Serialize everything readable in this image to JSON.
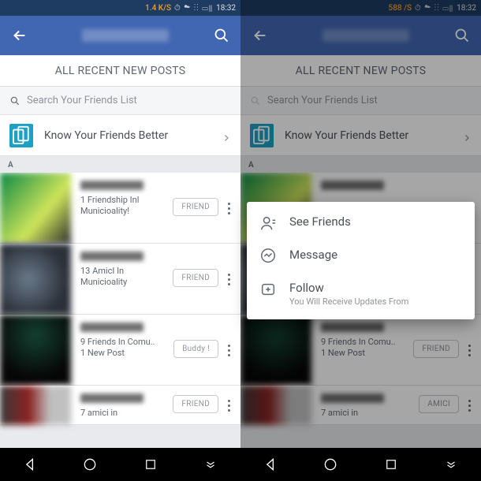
{
  "statusbar": {
    "left_speed": "1.4 K/S",
    "right_speed": "588 /S",
    "time": "18:32",
    "_icons": "⏰ 📶 🔋"
  },
  "header": {
    "back": "←",
    "search": "🔍"
  },
  "topnav_label": "ALL RECENT NEW POSTS",
  "search_placeholder": "Search Your Friends List",
  "know_label": "Know Your Friends Better",
  "section_header": "A",
  "buttons": {
    "friend": "FRIEND",
    "buddy": "Buddy !",
    "amici": "AMICI"
  },
  "items": [
    {
      "sub": "1 Friendship Inl",
      "sub2": "Municioality!",
      "btn": "friend"
    },
    {
      "sub": "13 AmicI In",
      "sub2": "Municioality",
      "btn": "friend"
    },
    {
      "sub": "9 Friends In Comu..",
      "sub2": "1 New Post",
      "btn": "buddy"
    },
    {
      "sub": "7 amici in",
      "sub2": "",
      "btn": "friend"
    }
  ],
  "items_right": [
    {
      "sub": "",
      "sub2": "",
      "btn": ""
    },
    {
      "sub": "",
      "sub2": "",
      "btn": ""
    },
    {
      "sub": "9 Friends In Comu..",
      "sub2": "1 New Post",
      "btn": "friend"
    },
    {
      "sub": "7 amici in",
      "sub2": "",
      "btn": "amici"
    }
  ],
  "popup": {
    "see_friends": "See Friends",
    "message": "Message",
    "follow": "Follow",
    "follow_sub": "You Will Receive Updates From"
  }
}
